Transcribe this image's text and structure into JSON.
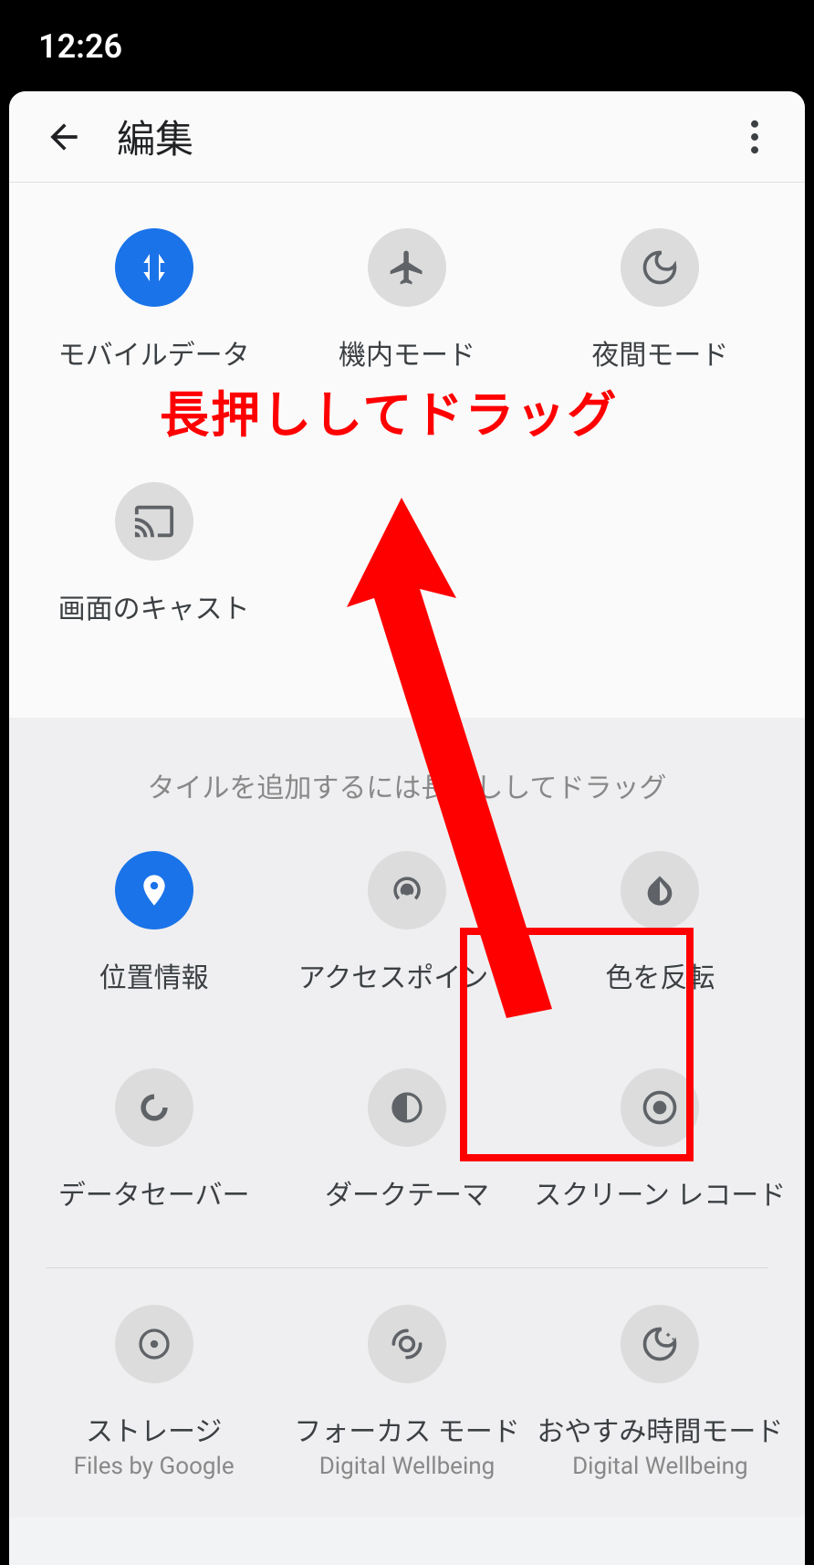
{
  "status": {
    "time": "12:26"
  },
  "header": {
    "title": "編集"
  },
  "active_tiles": [
    {
      "label": "モバイルデータ",
      "icon": "mobile-data",
      "on": true
    },
    {
      "label": "機内モード",
      "icon": "airplane",
      "on": false
    },
    {
      "label": "夜間モード",
      "icon": "night",
      "on": false
    },
    {
      "label": "画面のキャスト",
      "icon": "cast",
      "on": false
    }
  ],
  "hint": "タイルを追加するには長押ししてドラッグ",
  "inactive_tiles_row1": [
    {
      "label": "位置情報",
      "icon": "location",
      "on": true
    },
    {
      "label": "アクセスポイント",
      "icon": "hotspot",
      "on": false
    },
    {
      "label": "色を反転",
      "icon": "invert",
      "on": false
    }
  ],
  "inactive_tiles_row2": [
    {
      "label": "データセーバー",
      "icon": "datasaver",
      "on": false
    },
    {
      "label": "ダークテーマ",
      "icon": "dark",
      "on": false
    },
    {
      "label": "スクリーン レコード",
      "icon": "screenrec",
      "on": false
    }
  ],
  "inactive_tiles_row3": [
    {
      "label": "ストレージ",
      "sub": "Files by Google",
      "icon": "storage",
      "on": false
    },
    {
      "label": "フォーカス モード",
      "sub": "Digital Wellbeing",
      "icon": "focus",
      "on": false
    },
    {
      "label": "おやすみ時間モード",
      "sub": "Digital Wellbeing",
      "icon": "bedtime",
      "on": false
    }
  ],
  "annotation": {
    "text": "長押ししてドラッグ"
  }
}
